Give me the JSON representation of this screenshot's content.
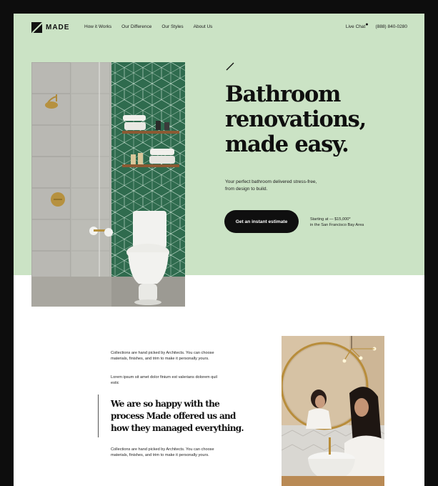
{
  "brand": {
    "name": "MADE"
  },
  "nav": {
    "links": [
      "How it Works",
      "Our Difference",
      "Our Styles",
      "About Us"
    ],
    "live_chat": "Live Chat",
    "live_dot": "●",
    "phone": "(888) 840-0280"
  },
  "hero": {
    "title_lines": [
      "Bathroom",
      "renovations,",
      "made easy."
    ],
    "subtitle": "Your perfect bathroom delivered stress-free, from design to build.",
    "cta_label": "Get an instant estimate",
    "price_line1": "Starting at — $15,000*",
    "price_line2": "in the San Francisco Bay Area",
    "image_subject": "bathroom-with-green-hexagon-tile-toilet-and-glass-shower"
  },
  "testimonial": {
    "copy_top": "Collections are hand picked by Architects. You can choose materials, finishes, and trim to make it personally yours.",
    "lorem": "Lorem ipsum sit amet dolor finium est valerians dolorem quil estic",
    "quote_lines": [
      "We are so happy with the",
      "process Made offered us and",
      "how they managed everything."
    ],
    "copy_bottom": "Collections are hand picked by Architects. You can choose materials, finishes, and trim to make it personally yours.",
    "image_subject": "woman-at-round-brass-mirror-over-vessel-sink"
  },
  "colors": {
    "hero_bg": "#cbe3c5",
    "ink": "#0f0f0f",
    "tile_green": "#2f6b4e",
    "frame": "#0d0d0d"
  }
}
